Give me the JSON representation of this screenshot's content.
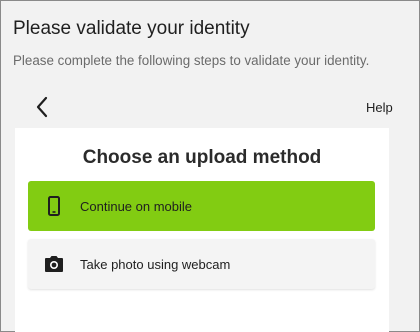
{
  "header": {
    "title": "Please validate your identity",
    "subtitle": "Please complete the following steps to validate your identity."
  },
  "nav": {
    "back_icon": "chevron-left-icon",
    "help_label": "Help"
  },
  "upload": {
    "heading": "Choose an upload method",
    "options": [
      {
        "label": "Continue on mobile",
        "icon": "mobile-phone-icon",
        "background": "#82cc12"
      },
      {
        "label": "Take photo using webcam",
        "icon": "camera-icon",
        "background": "#f4f4f4"
      }
    ]
  },
  "colors": {
    "accent": "#82cc12",
    "window_background": "#f2f2f2",
    "card_background": "#ffffff"
  }
}
